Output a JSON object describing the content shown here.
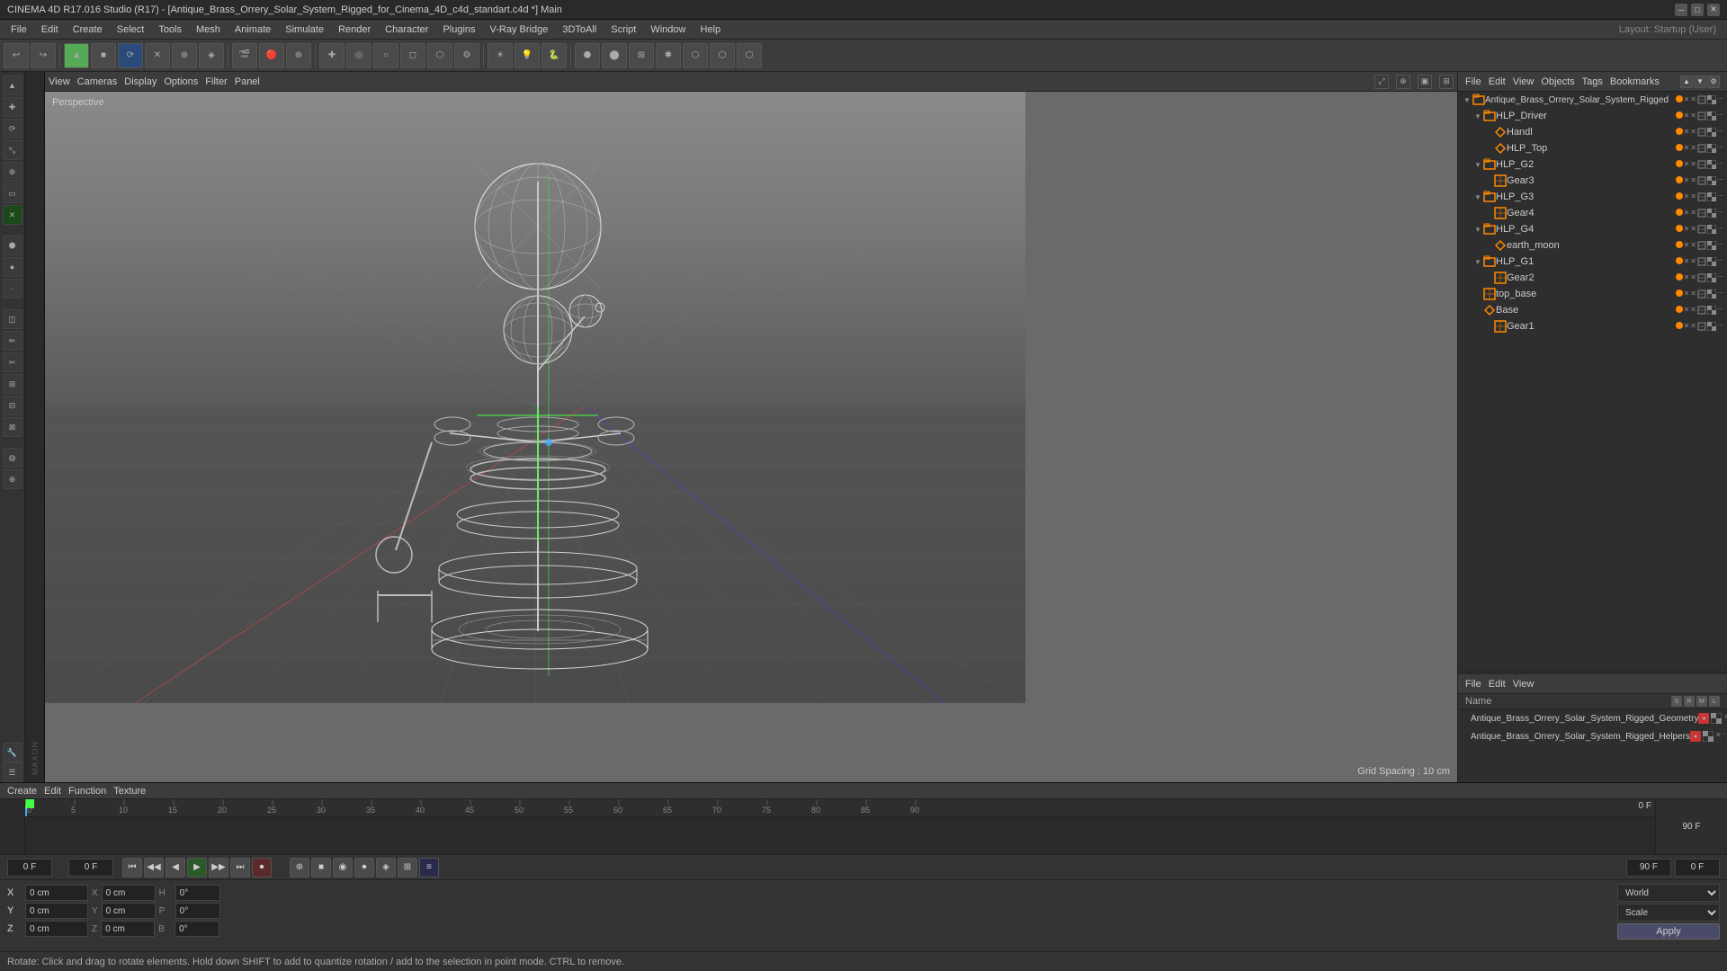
{
  "titlebar": {
    "title": "CINEMA 4D R17.016 Studio (R17) - [Antique_Brass_Orrery_Solar_System_Rigged_for_Cinema_4D_c4d_standart.c4d *] Main",
    "minimize": "─",
    "maximize": "□",
    "close": "✕"
  },
  "menubar": {
    "items": [
      "File",
      "Edit",
      "Create",
      "Select",
      "Tools",
      "Mesh",
      "Animate",
      "Simulate",
      "Render",
      "Character",
      "Plugins",
      "V-Ray Bridge",
      "3DToAll",
      "Script",
      "Window",
      "Help"
    ]
  },
  "toolbar": {
    "items": [
      "↩",
      "↪",
      "✚",
      "⊕",
      "↖",
      "⊗",
      "❂",
      "◈",
      "✦",
      "✦",
      "✦",
      "✦",
      "✦",
      "✦",
      "✦",
      "✦",
      "✦",
      "✦",
      "✦",
      "✦",
      "✦",
      "✦",
      "✦",
      "✦",
      "✦",
      "✦",
      "✦",
      "✦",
      "✦",
      "✦"
    ]
  },
  "viewport": {
    "perspective_label": "Perspective",
    "grid_spacing_label": "Grid Spacing : 10 cm"
  },
  "viewport_menu": {
    "items": [
      "View",
      "Cameras",
      "Display",
      "Options",
      "Filter",
      "Panel"
    ]
  },
  "right_panel": {
    "header_items": [
      "File",
      "Edit",
      "View",
      "Objects",
      "Tags",
      "Bookmarks"
    ],
    "layout_label": "Layout:",
    "layout_value": "Startup (User)"
  },
  "object_tree": {
    "items": [
      {
        "label": "Antique_Brass_Orrery_Solar_System_Rigged",
        "depth": 0,
        "expanded": true,
        "type": "group",
        "color": "orange"
      },
      {
        "label": "HLP_Driver",
        "depth": 1,
        "expanded": true,
        "type": "group",
        "color": "orange"
      },
      {
        "label": "Handl",
        "depth": 2,
        "expanded": false,
        "type": "bone",
        "color": "orange"
      },
      {
        "label": "HLP_Top",
        "depth": 2,
        "expanded": false,
        "type": "bone",
        "color": "orange"
      },
      {
        "label": "HLP_G2",
        "depth": 1,
        "expanded": true,
        "type": "group",
        "color": "orange"
      },
      {
        "label": "Gear3",
        "depth": 2,
        "expanded": false,
        "type": "mesh",
        "color": "orange"
      },
      {
        "label": "HLP_G3",
        "depth": 1,
        "expanded": true,
        "type": "group",
        "color": "orange"
      },
      {
        "label": "Gear4",
        "depth": 2,
        "expanded": false,
        "type": "mesh",
        "color": "orange"
      },
      {
        "label": "HLP_G4",
        "depth": 1,
        "expanded": true,
        "type": "group",
        "color": "orange"
      },
      {
        "label": "earth_moon",
        "depth": 2,
        "expanded": false,
        "type": "bone",
        "color": "orange"
      },
      {
        "label": "HLP_G1",
        "depth": 1,
        "expanded": true,
        "type": "group",
        "color": "orange"
      },
      {
        "label": "Gear2",
        "depth": 2,
        "expanded": false,
        "type": "mesh",
        "color": "orange"
      },
      {
        "label": "top_base",
        "depth": 1,
        "expanded": false,
        "type": "mesh",
        "color": "orange"
      },
      {
        "label": "Base",
        "depth": 1,
        "expanded": false,
        "type": "bone",
        "color": "orange"
      },
      {
        "label": "Gear1",
        "depth": 2,
        "expanded": false,
        "type": "mesh",
        "color": "orange"
      }
    ]
  },
  "materials_panel": {
    "header_items": [
      "File",
      "Edit",
      "View"
    ],
    "name_header": "Name",
    "items": [
      {
        "name": "Antique_Brass_Orrery_Solar_System_Rigged_Geometry",
        "color": "#f80"
      },
      {
        "name": "Antique_Brass_Orrery_Solar_System_Rigged_Helpers",
        "color": "#4a4"
      }
    ]
  },
  "timeline": {
    "ticks": [
      0,
      5,
      10,
      15,
      20,
      25,
      30,
      35,
      40,
      45,
      50,
      55,
      60,
      65,
      70,
      75,
      80,
      85,
      90
    ],
    "current_frame": "0 F",
    "end_frame": "90 F",
    "frame_display": "0 F"
  },
  "transport": {
    "start_frame": "0 F",
    "frame_val": "0 F",
    "frame_rate": "90 F",
    "fps_display": "0 F"
  },
  "transport_buttons": [
    "⏮",
    "◀",
    "◀",
    "▶",
    "▶",
    "⏭",
    "⏺"
  ],
  "properties": {
    "rows": [
      {
        "label": "X",
        "val1": "0 cm",
        "sub_label": "X",
        "sub_val": "0 cm",
        "letter": "H",
        "letter_val": "0°"
      },
      {
        "label": "Y",
        "val1": "0 cm",
        "sub_label": "Y",
        "sub_val": "0 cm",
        "letter": "P",
        "letter_val": "0°"
      },
      {
        "label": "Z",
        "val1": "0 cm",
        "sub_label": "Z",
        "sub_val": "0 cm",
        "letter": "B",
        "letter_val": "0°"
      }
    ],
    "dropdown1": "World",
    "dropdown2": "Scale",
    "apply_label": "Apply"
  },
  "bottom_strip": {
    "items": [
      "Create",
      "Edit",
      "Function",
      "Texture"
    ]
  },
  "status_bar": {
    "text": "Rotate: Click and drag to rotate elements. Hold down SHIFT to add to quantize rotation / add to the selection in point mode. CTRL to remove."
  },
  "left_tools": [
    "▲",
    "■",
    "⊕",
    "◉",
    "✕",
    "✕",
    "✕",
    "✕",
    "⬢",
    "●",
    "▶",
    "◈",
    "✦",
    "✦",
    "✦",
    "✦",
    "✦",
    "▣",
    "✦",
    "✦",
    "✦",
    "✦"
  ]
}
